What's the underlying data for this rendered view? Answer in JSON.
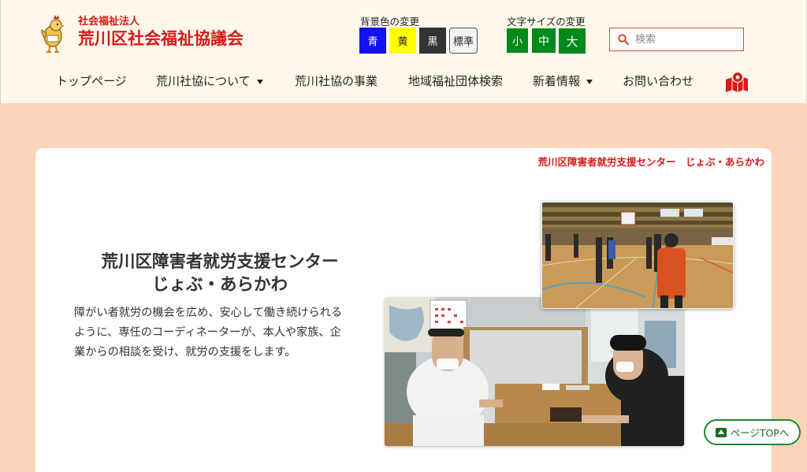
{
  "org": {
    "subtitle": "社会福祉法人",
    "name": "荒川区社会福祉協議会"
  },
  "bg_color": {
    "label": "背景色の変更",
    "options": [
      {
        "label": "青",
        "color": "#1212ef"
      },
      {
        "label": "黄",
        "color": "#ffff00"
      },
      {
        "label": "黒",
        "color": "#333333"
      },
      {
        "label": "標準",
        "color": "#f4f4f4"
      }
    ]
  },
  "font_size": {
    "label": "文字サイズの変更",
    "small": "小",
    "medium": "中",
    "large": "大",
    "color": "#008a1c"
  },
  "search": {
    "placeholder": "検索",
    "icon": "search-icon",
    "border_color": "#d94a3a"
  },
  "nav": {
    "items": [
      {
        "label": "トップページ",
        "has_dropdown": false
      },
      {
        "label": "荒川社協について",
        "has_dropdown": true
      },
      {
        "label": "荒川社協の事業",
        "has_dropdown": false
      },
      {
        "label": "地域福祉団体検索",
        "has_dropdown": false
      },
      {
        "label": "新着情報",
        "has_dropdown": true
      },
      {
        "label": "お問い合わせ",
        "has_dropdown": false
      }
    ],
    "map_icon": "map-marker-icon"
  },
  "breadcrumb": "荒川区障害者就労支援センター　じょぶ・あらかわ",
  "page": {
    "title_line1": "荒川区障害者就労支援センター",
    "title_line2": "じょぶ・あらかわ",
    "description": "障がい者就労の機会を広め、安心して働き続けられるように、専任のコーディネーターが、本人や家族、企業からの相談を受け、就労の支援をします。"
  },
  "page_top": {
    "label": "ページTOPへ"
  },
  "colors": {
    "brand_red": "#d71a1a",
    "page_bg": "#fbd4b9",
    "header_bg": "#fff8ea",
    "accent_green": "#1a8a2c"
  }
}
